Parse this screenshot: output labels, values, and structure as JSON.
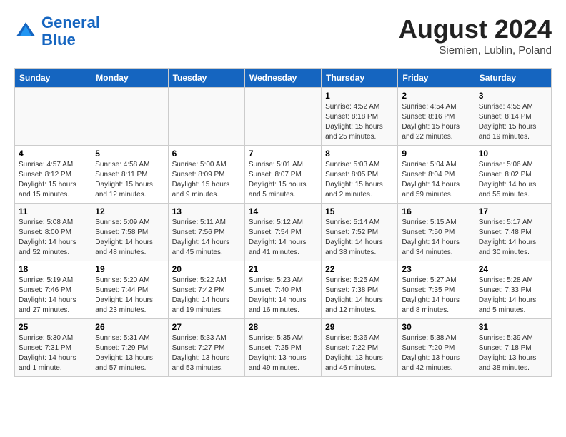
{
  "header": {
    "logo_line1": "General",
    "logo_line2": "Blue",
    "month_title": "August 2024",
    "location": "Siemien, Lublin, Poland"
  },
  "days_of_week": [
    "Sunday",
    "Monday",
    "Tuesday",
    "Wednesday",
    "Thursday",
    "Friday",
    "Saturday"
  ],
  "weeks": [
    [
      {
        "num": "",
        "detail": ""
      },
      {
        "num": "",
        "detail": ""
      },
      {
        "num": "",
        "detail": ""
      },
      {
        "num": "",
        "detail": ""
      },
      {
        "num": "1",
        "detail": "Sunrise: 4:52 AM\nSunset: 8:18 PM\nDaylight: 15 hours\nand 25 minutes."
      },
      {
        "num": "2",
        "detail": "Sunrise: 4:54 AM\nSunset: 8:16 PM\nDaylight: 15 hours\nand 22 minutes."
      },
      {
        "num": "3",
        "detail": "Sunrise: 4:55 AM\nSunset: 8:14 PM\nDaylight: 15 hours\nand 19 minutes."
      }
    ],
    [
      {
        "num": "4",
        "detail": "Sunrise: 4:57 AM\nSunset: 8:12 PM\nDaylight: 15 hours\nand 15 minutes."
      },
      {
        "num": "5",
        "detail": "Sunrise: 4:58 AM\nSunset: 8:11 PM\nDaylight: 15 hours\nand 12 minutes."
      },
      {
        "num": "6",
        "detail": "Sunrise: 5:00 AM\nSunset: 8:09 PM\nDaylight: 15 hours\nand 9 minutes."
      },
      {
        "num": "7",
        "detail": "Sunrise: 5:01 AM\nSunset: 8:07 PM\nDaylight: 15 hours\nand 5 minutes."
      },
      {
        "num": "8",
        "detail": "Sunrise: 5:03 AM\nSunset: 8:05 PM\nDaylight: 15 hours\nand 2 minutes."
      },
      {
        "num": "9",
        "detail": "Sunrise: 5:04 AM\nSunset: 8:04 PM\nDaylight: 14 hours\nand 59 minutes."
      },
      {
        "num": "10",
        "detail": "Sunrise: 5:06 AM\nSunset: 8:02 PM\nDaylight: 14 hours\nand 55 minutes."
      }
    ],
    [
      {
        "num": "11",
        "detail": "Sunrise: 5:08 AM\nSunset: 8:00 PM\nDaylight: 14 hours\nand 52 minutes."
      },
      {
        "num": "12",
        "detail": "Sunrise: 5:09 AM\nSunset: 7:58 PM\nDaylight: 14 hours\nand 48 minutes."
      },
      {
        "num": "13",
        "detail": "Sunrise: 5:11 AM\nSunset: 7:56 PM\nDaylight: 14 hours\nand 45 minutes."
      },
      {
        "num": "14",
        "detail": "Sunrise: 5:12 AM\nSunset: 7:54 PM\nDaylight: 14 hours\nand 41 minutes."
      },
      {
        "num": "15",
        "detail": "Sunrise: 5:14 AM\nSunset: 7:52 PM\nDaylight: 14 hours\nand 38 minutes."
      },
      {
        "num": "16",
        "detail": "Sunrise: 5:15 AM\nSunset: 7:50 PM\nDaylight: 14 hours\nand 34 minutes."
      },
      {
        "num": "17",
        "detail": "Sunrise: 5:17 AM\nSunset: 7:48 PM\nDaylight: 14 hours\nand 30 minutes."
      }
    ],
    [
      {
        "num": "18",
        "detail": "Sunrise: 5:19 AM\nSunset: 7:46 PM\nDaylight: 14 hours\nand 27 minutes."
      },
      {
        "num": "19",
        "detail": "Sunrise: 5:20 AM\nSunset: 7:44 PM\nDaylight: 14 hours\nand 23 minutes."
      },
      {
        "num": "20",
        "detail": "Sunrise: 5:22 AM\nSunset: 7:42 PM\nDaylight: 14 hours\nand 19 minutes."
      },
      {
        "num": "21",
        "detail": "Sunrise: 5:23 AM\nSunset: 7:40 PM\nDaylight: 14 hours\nand 16 minutes."
      },
      {
        "num": "22",
        "detail": "Sunrise: 5:25 AM\nSunset: 7:38 PM\nDaylight: 14 hours\nand 12 minutes."
      },
      {
        "num": "23",
        "detail": "Sunrise: 5:27 AM\nSunset: 7:35 PM\nDaylight: 14 hours\nand 8 minutes."
      },
      {
        "num": "24",
        "detail": "Sunrise: 5:28 AM\nSunset: 7:33 PM\nDaylight: 14 hours\nand 5 minutes."
      }
    ],
    [
      {
        "num": "25",
        "detail": "Sunrise: 5:30 AM\nSunset: 7:31 PM\nDaylight: 14 hours\nand 1 minute."
      },
      {
        "num": "26",
        "detail": "Sunrise: 5:31 AM\nSunset: 7:29 PM\nDaylight: 13 hours\nand 57 minutes."
      },
      {
        "num": "27",
        "detail": "Sunrise: 5:33 AM\nSunset: 7:27 PM\nDaylight: 13 hours\nand 53 minutes."
      },
      {
        "num": "28",
        "detail": "Sunrise: 5:35 AM\nSunset: 7:25 PM\nDaylight: 13 hours\nand 49 minutes."
      },
      {
        "num": "29",
        "detail": "Sunrise: 5:36 AM\nSunset: 7:22 PM\nDaylight: 13 hours\nand 46 minutes."
      },
      {
        "num": "30",
        "detail": "Sunrise: 5:38 AM\nSunset: 7:20 PM\nDaylight: 13 hours\nand 42 minutes."
      },
      {
        "num": "31",
        "detail": "Sunrise: 5:39 AM\nSunset: 7:18 PM\nDaylight: 13 hours\nand 38 minutes."
      }
    ]
  ]
}
